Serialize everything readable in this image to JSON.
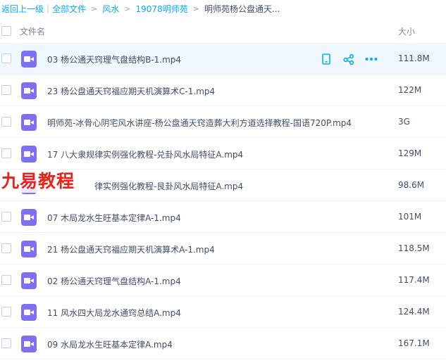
{
  "breadcrumb": {
    "back": "返回上一级",
    "sep_bar": "|",
    "all_files": "全部文件",
    "sep": ">",
    "level1": "风水",
    "level2": "19078明师苑",
    "current": "明师苑杨公盘通天..."
  },
  "header": {
    "name_label": "文件名",
    "size_label": "大小"
  },
  "files": [
    {
      "name": "03 杨公通天窍理气盘结构B-1.mp4",
      "size": "111.8M"
    },
    {
      "name": "23 杨公盘通天窍福应期天机演算术C-1.mp4",
      "size": "122M"
    },
    {
      "name": "明师苑-冰骨心阴宅风水讲座-杨公盘通天窍造葬大利方道选择教程-国语720P.mp4",
      "size": "3G"
    },
    {
      "name": "17 八大隶规律实例强化教程-兑卦风水局特征A.mp4",
      "size": "129M"
    },
    {
      "name": "律实例强化教程-艮卦风水局特征A.mp4",
      "size": "98.6M"
    },
    {
      "name": "07 木局龙水生旺基本定律A-1.mp4",
      "size": "101M"
    },
    {
      "name": "21 杨公盘通天窍福应期天机演算术A-1.mp4",
      "size": "118.5M"
    },
    {
      "name": "02 杨公通天窍理气盘结构A-1.mp4",
      "size": "117.4M"
    },
    {
      "name": "11 风水四大局龙水通窍总结A.mp4",
      "size": "124.4M"
    },
    {
      "name": "09 水局龙水生旺基本定律A.mp4",
      "size": "167.1M"
    }
  ],
  "watermark": "九易教程",
  "colors": {
    "link": "#09aaff",
    "video_icon": "#7e6ff3",
    "hover_row": "#f0f8ff",
    "watermark": "#e8231b"
  },
  "icons": {
    "row_actions": [
      "phone-icon",
      "share-icon",
      "more-icon"
    ]
  }
}
